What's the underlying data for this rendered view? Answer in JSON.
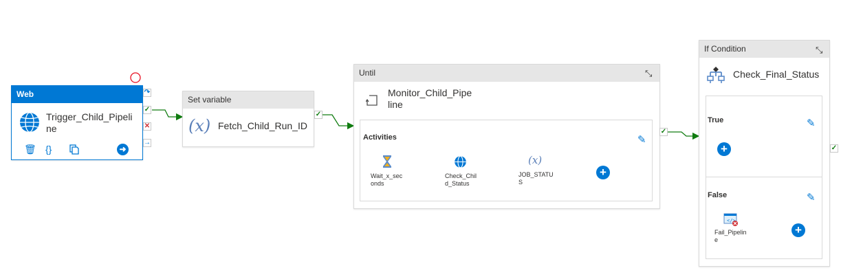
{
  "web_activity": {
    "type_label": "Web",
    "name": [
      "Trigger_Child_Pipeli",
      "ne"
    ],
    "icon": "globe-icon",
    "tools": [
      "delete-icon",
      "code-icon",
      "copy-icon",
      "arrow-right-icon"
    ]
  },
  "set_variable_activity": {
    "type_label": "Set variable",
    "symbol": "(𝑥)",
    "name": "Fetch_Child_Run_ID"
  },
  "until_activity": {
    "type_label": "Until",
    "name": [
      "Monitor_Child_Pipe",
      "line"
    ],
    "activities_label": "Activities",
    "inner": {
      "wait": [
        "Wait_x_sec",
        "onds"
      ],
      "check": [
        "Check_Chil",
        "d_Status"
      ],
      "job": [
        "JOB_STATU",
        "S"
      ],
      "symbol": "(𝑥)"
    }
  },
  "if_activity": {
    "type_label": "If Condition",
    "name": "Check_Final_Status",
    "true_label": "True",
    "false_label": "False",
    "fail": [
      "Fail_Pipelin",
      "e"
    ]
  },
  "colors": {
    "accent": "#0078d4",
    "success": "#107c10",
    "failure": "#d13438",
    "header_gray": "#e6e6e6"
  }
}
